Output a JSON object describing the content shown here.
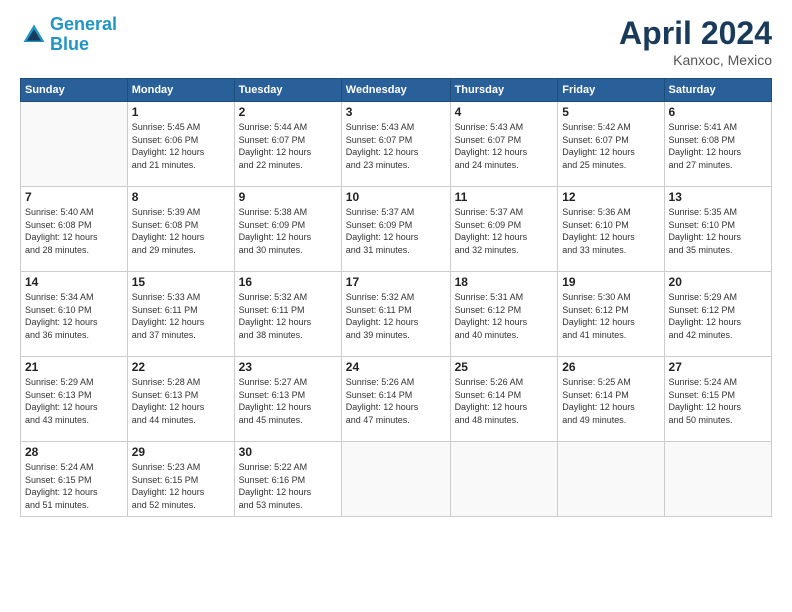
{
  "header": {
    "logo_line1": "General",
    "logo_line2": "Blue",
    "month": "April 2024",
    "location": "Kanxoc, Mexico"
  },
  "weekdays": [
    "Sunday",
    "Monday",
    "Tuesday",
    "Wednesday",
    "Thursday",
    "Friday",
    "Saturday"
  ],
  "weeks": [
    [
      {
        "day": "",
        "info": ""
      },
      {
        "day": "1",
        "info": "Sunrise: 5:45 AM\nSunset: 6:06 PM\nDaylight: 12 hours\nand 21 minutes."
      },
      {
        "day": "2",
        "info": "Sunrise: 5:44 AM\nSunset: 6:07 PM\nDaylight: 12 hours\nand 22 minutes."
      },
      {
        "day": "3",
        "info": "Sunrise: 5:43 AM\nSunset: 6:07 PM\nDaylight: 12 hours\nand 23 minutes."
      },
      {
        "day": "4",
        "info": "Sunrise: 5:43 AM\nSunset: 6:07 PM\nDaylight: 12 hours\nand 24 minutes."
      },
      {
        "day": "5",
        "info": "Sunrise: 5:42 AM\nSunset: 6:07 PM\nDaylight: 12 hours\nand 25 minutes."
      },
      {
        "day": "6",
        "info": "Sunrise: 5:41 AM\nSunset: 6:08 PM\nDaylight: 12 hours\nand 27 minutes."
      }
    ],
    [
      {
        "day": "7",
        "info": "Sunrise: 5:40 AM\nSunset: 6:08 PM\nDaylight: 12 hours\nand 28 minutes."
      },
      {
        "day": "8",
        "info": "Sunrise: 5:39 AM\nSunset: 6:08 PM\nDaylight: 12 hours\nand 29 minutes."
      },
      {
        "day": "9",
        "info": "Sunrise: 5:38 AM\nSunset: 6:09 PM\nDaylight: 12 hours\nand 30 minutes."
      },
      {
        "day": "10",
        "info": "Sunrise: 5:37 AM\nSunset: 6:09 PM\nDaylight: 12 hours\nand 31 minutes."
      },
      {
        "day": "11",
        "info": "Sunrise: 5:37 AM\nSunset: 6:09 PM\nDaylight: 12 hours\nand 32 minutes."
      },
      {
        "day": "12",
        "info": "Sunrise: 5:36 AM\nSunset: 6:10 PM\nDaylight: 12 hours\nand 33 minutes."
      },
      {
        "day": "13",
        "info": "Sunrise: 5:35 AM\nSunset: 6:10 PM\nDaylight: 12 hours\nand 35 minutes."
      }
    ],
    [
      {
        "day": "14",
        "info": "Sunrise: 5:34 AM\nSunset: 6:10 PM\nDaylight: 12 hours\nand 36 minutes."
      },
      {
        "day": "15",
        "info": "Sunrise: 5:33 AM\nSunset: 6:11 PM\nDaylight: 12 hours\nand 37 minutes."
      },
      {
        "day": "16",
        "info": "Sunrise: 5:32 AM\nSunset: 6:11 PM\nDaylight: 12 hours\nand 38 minutes."
      },
      {
        "day": "17",
        "info": "Sunrise: 5:32 AM\nSunset: 6:11 PM\nDaylight: 12 hours\nand 39 minutes."
      },
      {
        "day": "18",
        "info": "Sunrise: 5:31 AM\nSunset: 6:12 PM\nDaylight: 12 hours\nand 40 minutes."
      },
      {
        "day": "19",
        "info": "Sunrise: 5:30 AM\nSunset: 6:12 PM\nDaylight: 12 hours\nand 41 minutes."
      },
      {
        "day": "20",
        "info": "Sunrise: 5:29 AM\nSunset: 6:12 PM\nDaylight: 12 hours\nand 42 minutes."
      }
    ],
    [
      {
        "day": "21",
        "info": "Sunrise: 5:29 AM\nSunset: 6:13 PM\nDaylight: 12 hours\nand 43 minutes."
      },
      {
        "day": "22",
        "info": "Sunrise: 5:28 AM\nSunset: 6:13 PM\nDaylight: 12 hours\nand 44 minutes."
      },
      {
        "day": "23",
        "info": "Sunrise: 5:27 AM\nSunset: 6:13 PM\nDaylight: 12 hours\nand 45 minutes."
      },
      {
        "day": "24",
        "info": "Sunrise: 5:26 AM\nSunset: 6:14 PM\nDaylight: 12 hours\nand 47 minutes."
      },
      {
        "day": "25",
        "info": "Sunrise: 5:26 AM\nSunset: 6:14 PM\nDaylight: 12 hours\nand 48 minutes."
      },
      {
        "day": "26",
        "info": "Sunrise: 5:25 AM\nSunset: 6:14 PM\nDaylight: 12 hours\nand 49 minutes."
      },
      {
        "day": "27",
        "info": "Sunrise: 5:24 AM\nSunset: 6:15 PM\nDaylight: 12 hours\nand 50 minutes."
      }
    ],
    [
      {
        "day": "28",
        "info": "Sunrise: 5:24 AM\nSunset: 6:15 PM\nDaylight: 12 hours\nand 51 minutes."
      },
      {
        "day": "29",
        "info": "Sunrise: 5:23 AM\nSunset: 6:15 PM\nDaylight: 12 hours\nand 52 minutes."
      },
      {
        "day": "30",
        "info": "Sunrise: 5:22 AM\nSunset: 6:16 PM\nDaylight: 12 hours\nand 53 minutes."
      },
      {
        "day": "",
        "info": ""
      },
      {
        "day": "",
        "info": ""
      },
      {
        "day": "",
        "info": ""
      },
      {
        "day": "",
        "info": ""
      }
    ]
  ]
}
